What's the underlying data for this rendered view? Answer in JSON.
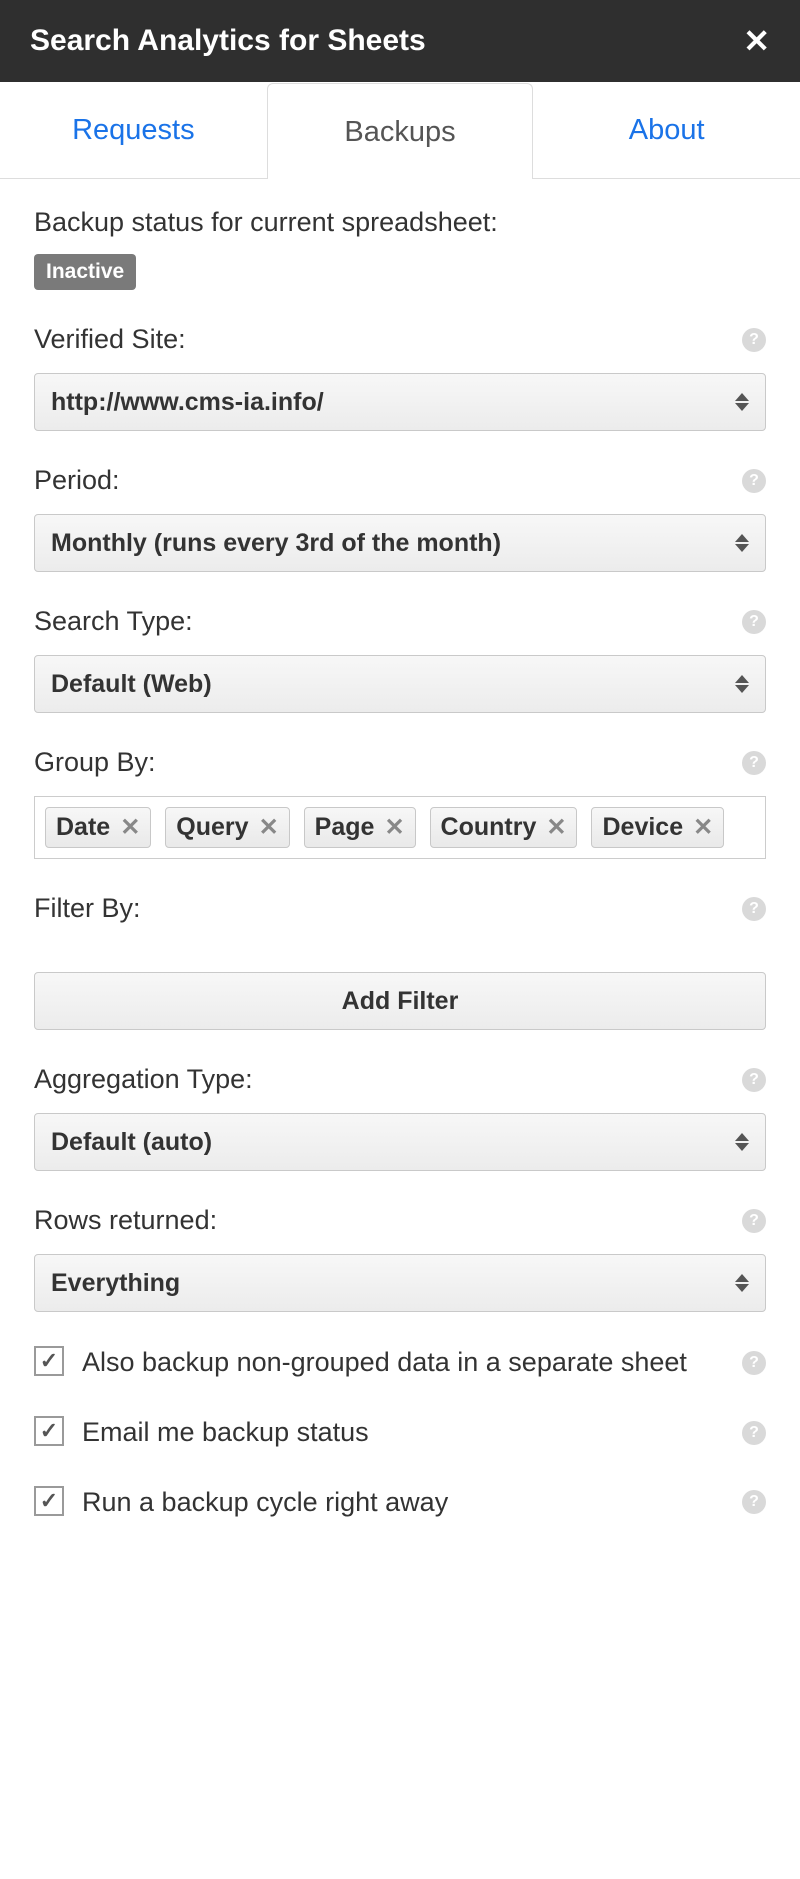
{
  "header": {
    "title": "Search Analytics for Sheets",
    "close_icon": "✕"
  },
  "tabs": [
    {
      "label": "Requests",
      "active": false
    },
    {
      "label": "Backups",
      "active": true
    },
    {
      "label": "About",
      "active": false
    }
  ],
  "status": {
    "label": "Backup status for current spreadsheet:",
    "badge": "Inactive"
  },
  "fields": {
    "verified_site": {
      "label": "Verified Site:",
      "value": "http://www.cms-ia.info/"
    },
    "period": {
      "label": "Period:",
      "value": "Monthly (runs every 3rd of the month)"
    },
    "search_type": {
      "label": "Search Type:",
      "value": "Default (Web)"
    },
    "group_by": {
      "label": "Group By:",
      "chips": [
        "Date",
        "Query",
        "Page",
        "Country",
        "Device"
      ]
    },
    "filter_by": {
      "label": "Filter By:",
      "button": "Add Filter"
    },
    "aggregation": {
      "label": "Aggregation Type:",
      "value": "Default (auto)"
    },
    "rows_returned": {
      "label": "Rows returned:",
      "value": "Everything"
    }
  },
  "checkboxes": [
    {
      "label": "Also backup non-grouped data in a separate sheet",
      "checked": true
    },
    {
      "label": "Email me backup status",
      "checked": true
    },
    {
      "label": "Run a backup cycle right away",
      "checked": true
    }
  ],
  "glyphs": {
    "check": "✓",
    "chip_x": "✕",
    "help": "?"
  }
}
